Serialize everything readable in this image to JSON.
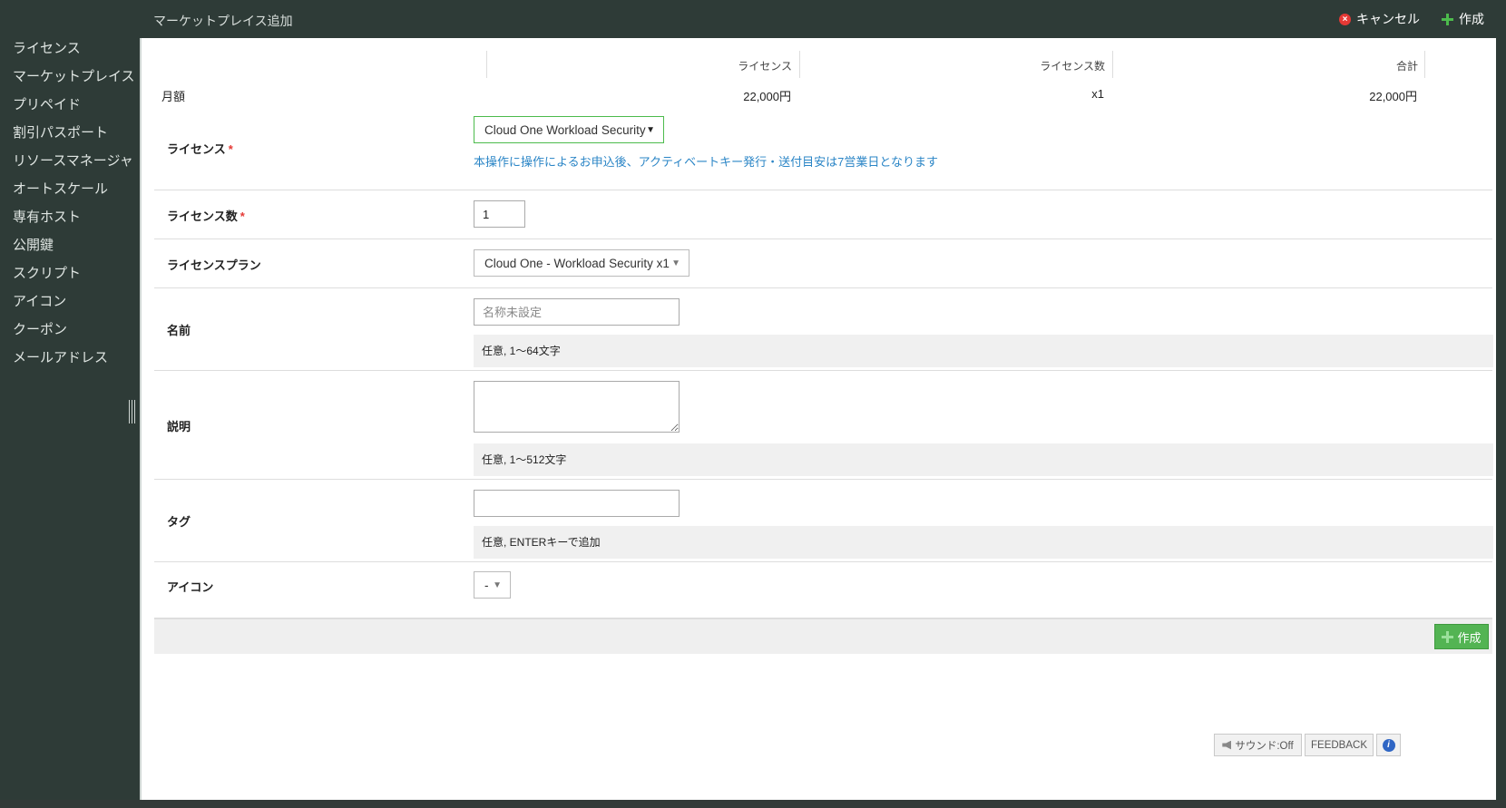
{
  "header": {
    "title": "マーケットプレイス追加",
    "cancel_label": "キャンセル",
    "create_label": "作成"
  },
  "sidebar": {
    "items": [
      {
        "label": "ライセンス"
      },
      {
        "label": "マーケットプレイス"
      },
      {
        "label": "プリペイド"
      },
      {
        "label": "割引パスポート"
      },
      {
        "label": "リソースマネージャ"
      },
      {
        "label": "オートスケール"
      },
      {
        "label": "専有ホスト"
      },
      {
        "label": "公開鍵"
      },
      {
        "label": "スクリプト"
      },
      {
        "label": "アイコン"
      },
      {
        "label": "クーポン"
      },
      {
        "label": "メールアドレス"
      }
    ]
  },
  "pricing": {
    "headers": {
      "license": "ライセンス",
      "count": "ライセンス数",
      "total": "合計"
    },
    "row_label": "月額",
    "license_price": "22,000円",
    "count": "x1",
    "total": "22,000円"
  },
  "form": {
    "license": {
      "label": "ライセンス",
      "required_mark": "*",
      "value": "Cloud One Workload Security",
      "note": "本操作に操作によるお申込後、アクティベートキー発行・送付目安は7営業日となります"
    },
    "license_count": {
      "label": "ライセンス数",
      "required_mark": "*",
      "value": "1"
    },
    "license_plan": {
      "label": "ライセンスプラン",
      "value": "Cloud One - Workload Security x1"
    },
    "name": {
      "label": "名前",
      "placeholder": "名称未設定",
      "hint": "任意, 1～64文字"
    },
    "description": {
      "label": "説明",
      "hint": "任意, 1～512文字"
    },
    "tag": {
      "label": "タグ",
      "hint": "任意, ENTERキーで追加"
    },
    "icon": {
      "label": "アイコン",
      "value": "-"
    },
    "create_label": "作成"
  },
  "utility": {
    "sound_label": "サウンド:Off",
    "feedback_label": "FEEDBACK",
    "info_symbol": "i"
  }
}
